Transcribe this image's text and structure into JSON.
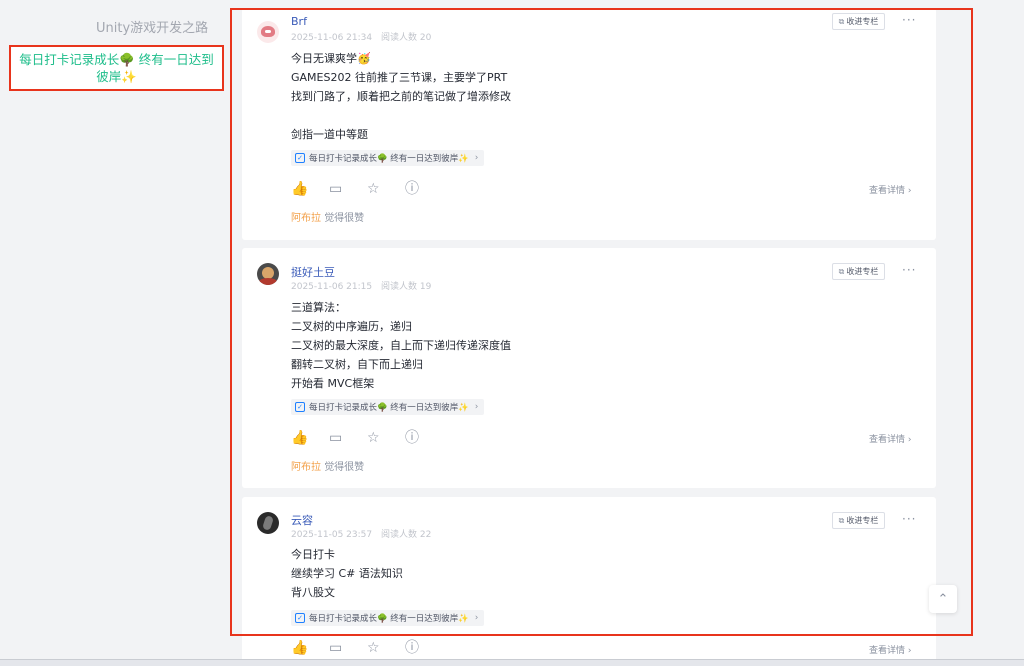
{
  "sidebar": {
    "title": "Unity游戏开发之路",
    "active_item": "每日打卡记录成长🌳 终有一日达到彼岸✨"
  },
  "common": {
    "collect_label": "收进专栏",
    "more_label": "···",
    "topic_label": "每日打卡记录成长🌳 终有一日达到彼岸✨",
    "detail_label": "查看详情",
    "liked_suffix": "觉得很赞"
  },
  "icons": {
    "like": "thumbs-up-icon",
    "comment": "comment-icon",
    "star": "star-icon",
    "report": "report-icon",
    "back_to_top": "arrow-up-icon"
  },
  "colors": {
    "accent": "#1e80ff",
    "highlight_border": "#e8341c",
    "liked": "#f3a24c",
    "sidebar_active": "#1dbd8a"
  },
  "posts": [
    {
      "author": "Brf",
      "time": "2025-11-06 21:34",
      "reads": "阅读人数 20",
      "lines": [
        "今日无课爽学🥳",
        "GAMES202 往前推了三节课，主要学了PRT",
        "找到门路了，顺着把之前的笔记做了增添修改",
        "",
        "剑指一道中等题"
      ],
      "liked_by": "阿布拉"
    },
    {
      "author": "挺好土豆",
      "time": "2025-11-06 21:15",
      "reads": "阅读人数 19",
      "lines": [
        "三道算法：",
        "二叉树的中序遍历，递归",
        "二叉树的最大深度，自上而下递归传递深度值",
        "翻转二叉树，自下而上递归",
        "开始看 MVC框架"
      ],
      "liked_by": "阿布拉"
    },
    {
      "author": "云容",
      "time": "2025-11-05 23:57",
      "reads": "阅读人数 22",
      "lines": [
        "今日打卡",
        "继续学习 C# 语法知识",
        "背八股文"
      ],
      "liked_by": ""
    }
  ]
}
